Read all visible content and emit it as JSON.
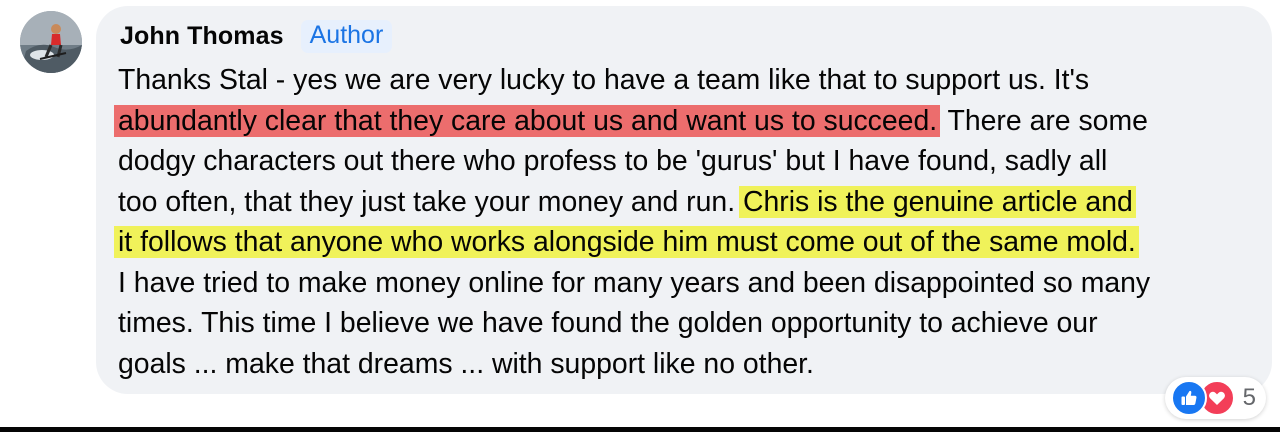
{
  "comment": {
    "author": "John Thomas",
    "badge": "Author",
    "avatar_icon": "user-avatar-photo",
    "lines": [
      "Thanks Stal - yes we are very lucky to have a team like that to support us. It's",
      "abundantly clear that they care about us and want us to succeed.",
      " There are some",
      "dodgy characters out there who profess to be 'gurus' but I have found, sadly all",
      "too often, that they just take your money and run. ",
      "Chris is the genuine article and",
      "it follows that anyone who works alongside him must come out of the same mold.",
      "I have tried to make money online for many years and been disappointed so many",
      "times. This time I believe we have found the golden opportunity to achieve our",
      "goals ... make that dreams ... with support like no other."
    ],
    "highlight_colors": {
      "red": "#ec6d6d",
      "yellow": "#f0f25a"
    }
  },
  "reactions": {
    "icons": [
      "like-icon",
      "love-icon"
    ],
    "count": "5"
  },
  "colors": {
    "bubble_bg": "#f0f2f5",
    "badge_bg": "#e7f0fd",
    "badge_text": "#1b74e4",
    "like_blue": "#1877f2",
    "love_red": "#f33e58"
  }
}
